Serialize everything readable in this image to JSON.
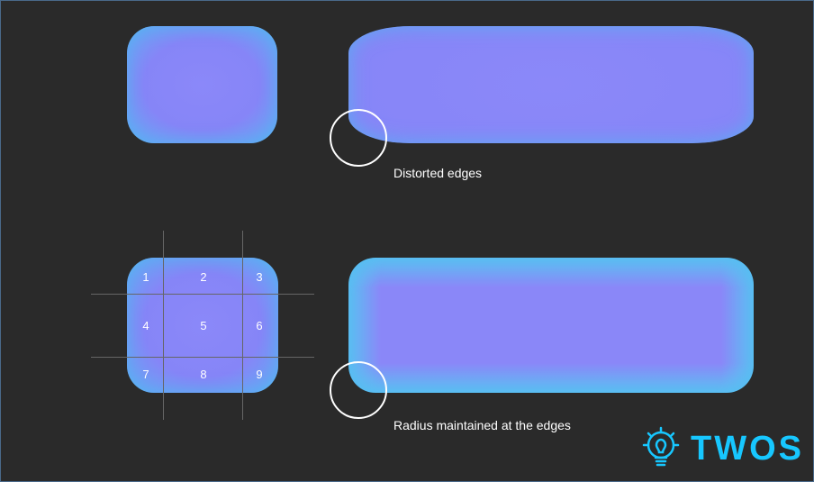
{
  "labels": {
    "distorted": "Distorted edges",
    "maintained": "Radius maintained at the edges"
  },
  "grid": {
    "n1": "1",
    "n2": "2",
    "n3": "3",
    "n4": "4",
    "n5": "5",
    "n6": "6",
    "n7": "7",
    "n8": "8",
    "n9": "9"
  },
  "watermark": {
    "text": "TWOS"
  },
  "colors": {
    "shape_fill": "#8a87f8",
    "shape_edge": "#58c8f2",
    "accent": "#17c7ff",
    "background": "#2a2a2a"
  }
}
